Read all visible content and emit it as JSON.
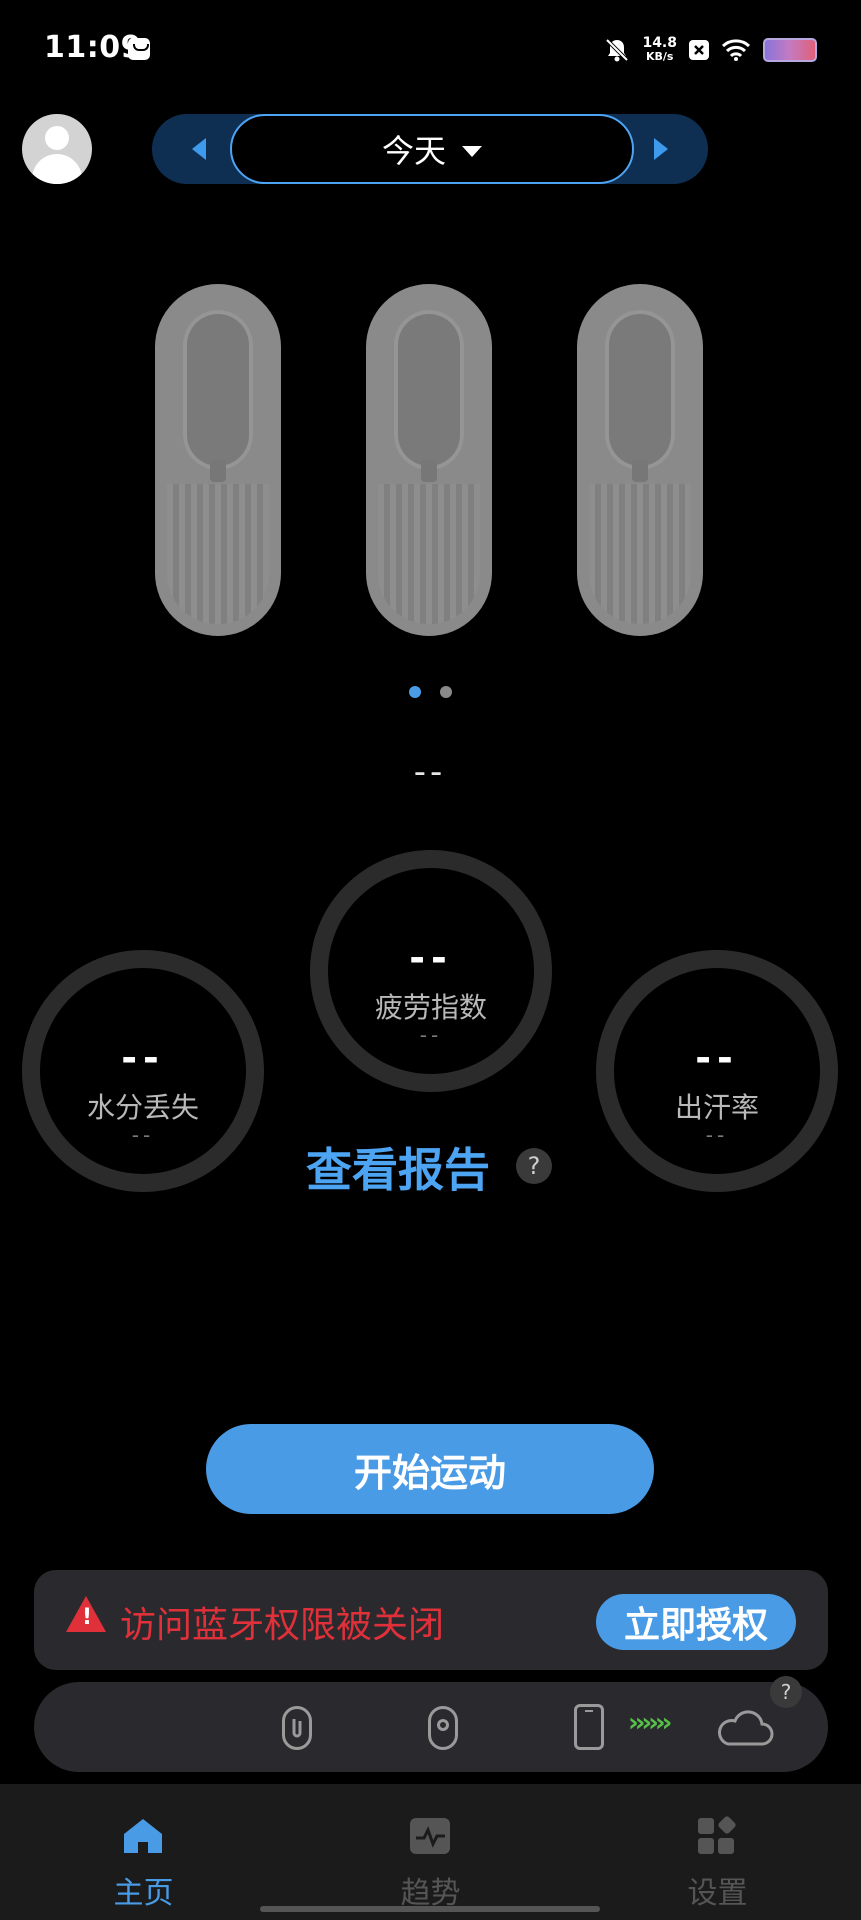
{
  "status_bar": {
    "time": "11:09",
    "speed_value": "14.8",
    "speed_unit": "KB/s"
  },
  "header": {
    "date_label": "今天"
  },
  "device_carousel": {
    "page_count": 2,
    "active_page": 1
  },
  "summary": {
    "top_value": "--"
  },
  "metrics": {
    "water_loss": {
      "value": "--",
      "label": "水分丢失",
      "sub": "--"
    },
    "fatigue": {
      "value": "--",
      "label": "疲劳指数",
      "sub": "--"
    },
    "sweat_rate": {
      "value": "--",
      "label": "出汗率",
      "sub": "--"
    }
  },
  "report": {
    "link_label": "查看报告",
    "help": "?"
  },
  "actions": {
    "start_label": "开始运动"
  },
  "bluetooth_warning": {
    "text": "访问蓝牙权限被关闭",
    "button_label": "立即授权"
  },
  "connection": {
    "chevrons": "››››››",
    "help": "?"
  },
  "nav": {
    "items": [
      {
        "label": "主页",
        "color": "#4a9be6"
      },
      {
        "label": "趋势",
        "color": "#555555"
      },
      {
        "label": "设置",
        "color": "#555555"
      }
    ]
  },
  "colors": {
    "accent": "#4a9be6",
    "warning": "#e0303a",
    "ok": "#58c04a"
  }
}
